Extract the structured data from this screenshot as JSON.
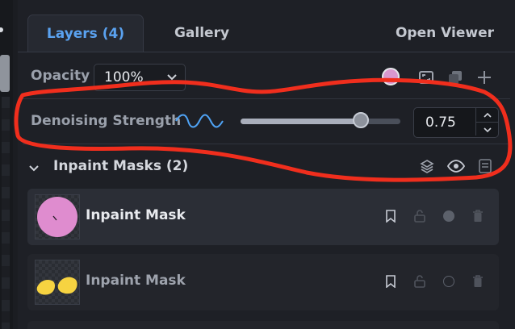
{
  "tabs": [
    {
      "label": "Layers (4)",
      "active": true
    },
    {
      "label": "Gallery",
      "active": false
    },
    {
      "label": "Open Viewer",
      "active": false
    }
  ],
  "opacity": {
    "label": "Opacity",
    "value": "100%"
  },
  "fill_color": "#d998cf",
  "denoise": {
    "label": "Denoising Strength",
    "value": "0.75",
    "slider_fraction": 0.75
  },
  "group": {
    "title": "Inpaint Masks (2)"
  },
  "layers": [
    {
      "name": "Inpaint Mask",
      "selected": true,
      "thumb_color": "#df8ccf"
    },
    {
      "name": "Inpaint Mask",
      "selected": false,
      "thumb_color": "#f6d341"
    }
  ],
  "colors": {
    "accent": "#5aa2f0",
    "annotation": "#f02e1d"
  },
  "icons": [
    "chevron-down-icon",
    "wave-icon",
    "fit-icon",
    "duplicate-icon",
    "plus-icon",
    "layers-icon",
    "eye-icon",
    "delete-icon",
    "bookmark-icon",
    "lock-icon",
    "visibility-dot-icon",
    "trash-icon"
  ]
}
